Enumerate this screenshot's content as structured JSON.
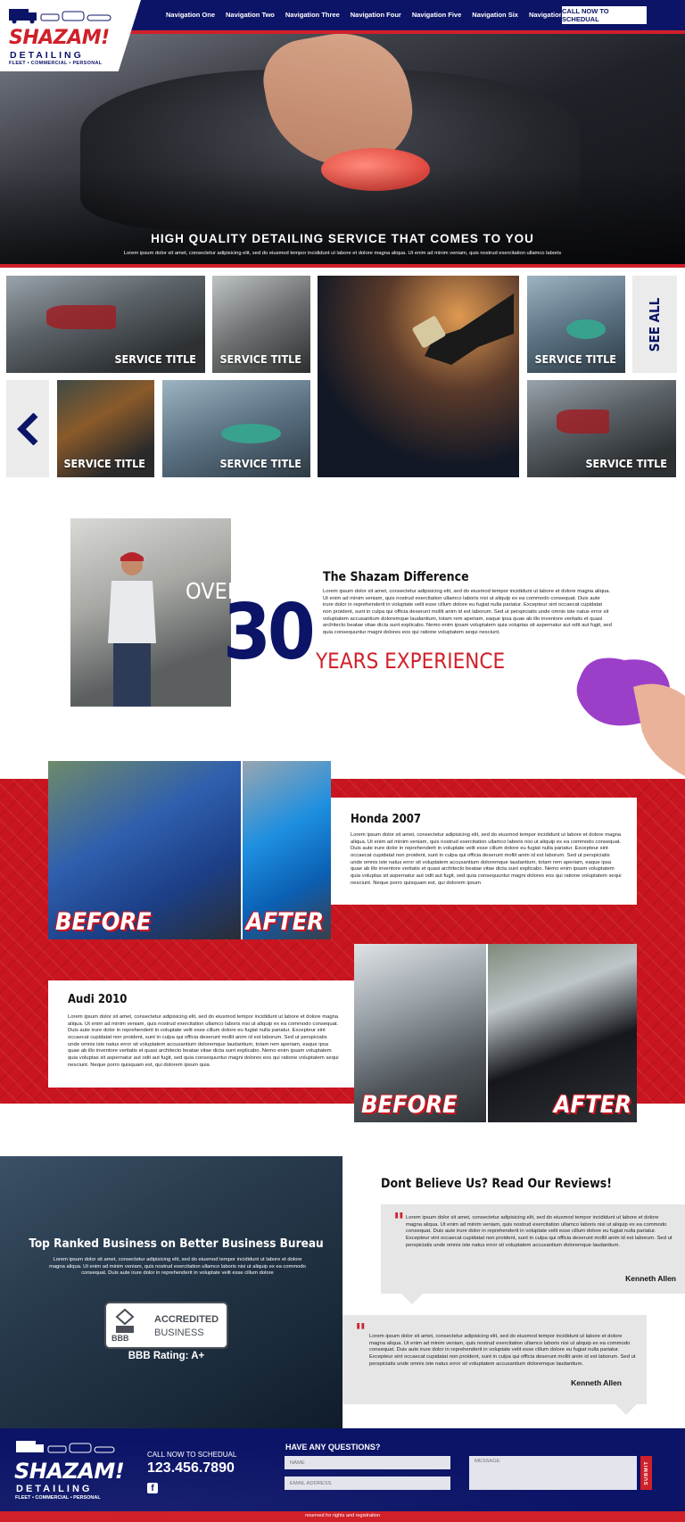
{
  "header": {
    "logo": {
      "word": "SHAZAM!",
      "sub": "DETAILING",
      "tagline": "FLEET • COMMERCIAL • PERSONAL"
    },
    "nav": [
      "Navigation One",
      "Navigation Two",
      "Navigation Three",
      "Navigation Four",
      "Navigation Five",
      "Navigation Six",
      "Navigation Seven"
    ],
    "cta_label": "CALL NOW TO SCHEDUAL"
  },
  "hero": {
    "title": "HIGH QUALITY DETAILING SERVICE THAT COMES TO YOU",
    "subtitle": "Lorem ipsum dolor sit amet, consectetur adipisicing elit, sed do eiusmod tempor incididunt ut labore et dolore magna aliqua. Ut enim ad minim veniam, quis nostrud exercitation ullamco laboris"
  },
  "services": {
    "tiles": [
      {
        "label": "SERVICE TITLE"
      },
      {
        "label": "SERVICE TITLE"
      },
      {
        "label": ""
      },
      {
        "label": "SERVICE TITLE"
      },
      {
        "label": "SERVICE TITLE"
      },
      {
        "label": "SERVICE TITLE"
      },
      {
        "label": "SERVICE TITLE"
      }
    ],
    "see_all": "SEE ALL"
  },
  "experience": {
    "over": "OVER",
    "number": "30",
    "years": "YEARS EXPERIENCE",
    "title": "The Shazam Difference",
    "text": "Lorem ipsum dolor sit amet, consectetur adipisicing elit, sed do eiusmod tempor incididunt ut labore et dolore magna aliqua. Ut enim ad minim veniam, quis nostrud exercitation ullamco laboris nisi ut aliquip ex ea commodo consequat. Duis aute irure dolor in reprehenderit in voluptate velit esse cillum dolore eu fugiat nulla pariatur. Excepteur sint occaecat cupidatat non proident, sunt in culpa qui officia deserunt mollit anim id est laborum. Sed ut perspiciatis unde omnis iste natus error sit voluptatem accusantium doloremque laudantium, totam rem aperiam, eaque ipsa quae ab illo inventore veritatis et quasi architecto beatae vitae dicta sunt explicabo. Nemo enim ipsam voluptatem quia voluptas sit aspernatur aut odit aut fugit, sed quia consequuntur magni dolores eos qui ratione voluptatem sequi nesciunt."
  },
  "before_after": [
    {
      "title": "Honda 2007",
      "text": "Lorem ipsum dolor sit amet, consectetur adipisicing elit, sed do eiusmod tempor incididunt ut labore et dolore magna aliqua. Ut enim ad minim veniam, quis nostrud exercitation ullamco laboris nisi ut aliquip ex ea commodo consequat. Duis aute irure dolor in reprehenderit in voluptate velit esse cillum dolore eu fugiat nulla pariatur. Excepteur sint occaecat cupidatat non proident, sunt in culpa qui officia deserunt mollit anim id est laborum. Sed ut perspiciatis unde omnis iste natus error sit voluptatem accusantium doloremque laudantium, totam rem aperiam, eaque ipsa quae ab illo inventore veritatis et quasi architecto beatae vitae dicta sunt explicabo. Nemo enim ipsam voluptatem quia voluptas sit aspernatur aut odit aut fugit, sed quia consequuntur magni dolores eos qui ratione voluptatem sequi nesciunt. Neque porro quisquam est, qui dolorem ipsum",
      "before": "BEFORE",
      "after": "AFTER"
    },
    {
      "title": "Audi 2010",
      "text": "Lorem ipsum dolor sit amet, consectetur adipisicing elit, sed do eiusmod tempor incididunt ut labore et dolore magna aliqua. Ut enim ad minim veniam, quis nostrud exercitation ullamco laboris nisi ut aliquip ex ea commodo consequat. Duis aute irure dolor in reprehenderit in voluptate velit esse cillum dolore eu fugiat nulla pariatur. Excepteur sint occaecat cupidatat non proident, sunt in culpa qui officia deserunt mollit anim id est laborum. Sed ut perspiciatis unde omnis iste natus error sit voluptatem accusantium doloremque laudantium, totam rem aperiam, eaque ipsa quae ab illo inventore veritatis et quasi architecto beatae vitae dicta sunt explicabo. Nemo enim ipsam voluptatem quia voluptas sit aspernatur aut odit aut fugit, sed quia consequuntur magni dolores eos qui ratione voluptatem sequi nesciunt. Neque porro quisquam est, qui dolorem ipsum quia",
      "before": "BEFORE",
      "after": "AFTER"
    }
  ],
  "bbb": {
    "title": "Top Ranked Business on Better Business Bureau",
    "text": "Lorem ipsum dolor sit amet, consectetur adipisicing elit, sed do eiusmod tempor incididunt ut labore et dolore magna aliqua. Ut enim ad minim veniam, quis nostrud exercitation ullamco laboris nisi ut aliquip ex ea commodo consequat. Duis aute irure dolor in reprehenderit in voluptate velit esse cillum dolore",
    "badge_logo": "BBB",
    "badge_line1": "ACCREDITED",
    "badge_line2": "BUSINESS",
    "rating": "BBB Rating: A+"
  },
  "reviews": {
    "title": "Dont Believe Us? Read Our Reviews!",
    "items": [
      {
        "text": "Lorem ipsum dolor sit amet, consectetur adipisicing elit, sed do eiusmod tempor incididunt ut labore et dolore magna aliqua. Ut enim ad minim veniam, quis nostrud exercitation ullamco laboris nisi ut aliquip ex ea commodo consequat. Duis aute irure dolor in reprehenderit in voluptate velit esse cillum dolore eu fugiat nulla pariatur. Excepteur sint occaecat cupidatat non proident, sunt in culpa qui officia deserunt mollit anim id est laborum. Sed ut perspiciatis unde omnis iste natus error sit voluptatem accusantium doloremque laudantium.",
        "author": "Kenneth Allen"
      },
      {
        "text": "Lorem ipsum dolor sit amet, consectetur adipisicing elit, sed do eiusmod tempor incididunt ut labore et dolore magna aliqua. Ut enim ad minim veniam, quis nostrud exercitation ullamco laboris nisi ut aliquip ex ea commodo consequat. Duis aute irure dolor in reprehenderit in voluptate velit esse cillum dolore eu fugiat nulla pariatur. Excepteur sint occaecat cupidatat non proident, sunt in culpa qui officia deserunt mollit anim id est laborum. Sed ut perspiciatis unde omnis iste natus error sit voluptatem accusantium doloremque laudantium.",
        "author": "Kenneth Allen"
      }
    ]
  },
  "footer": {
    "logo": {
      "word": "SHAZAM!",
      "sub": "DETAILING",
      "tagline": "FLEET • COMMERCIAL • PERSONAL"
    },
    "call_label": "CALL NOW TO SCHEDUAL",
    "phone": "123.456.7890",
    "facebook_glyph": "f",
    "questions_title": "HAVE ANY QUESTIONS?",
    "name_placeholder": "NAME",
    "email_placeholder": "EMAIL ADDRESS",
    "message_placeholder": "MESSAGE",
    "submit_label": "SUBMIT",
    "copyright": "reserved for rights and registration"
  },
  "colors": {
    "navy": "#0c1467",
    "red": "#d0202a",
    "band_red": "#c9151f",
    "card_gray": "#e6e6e6"
  }
}
